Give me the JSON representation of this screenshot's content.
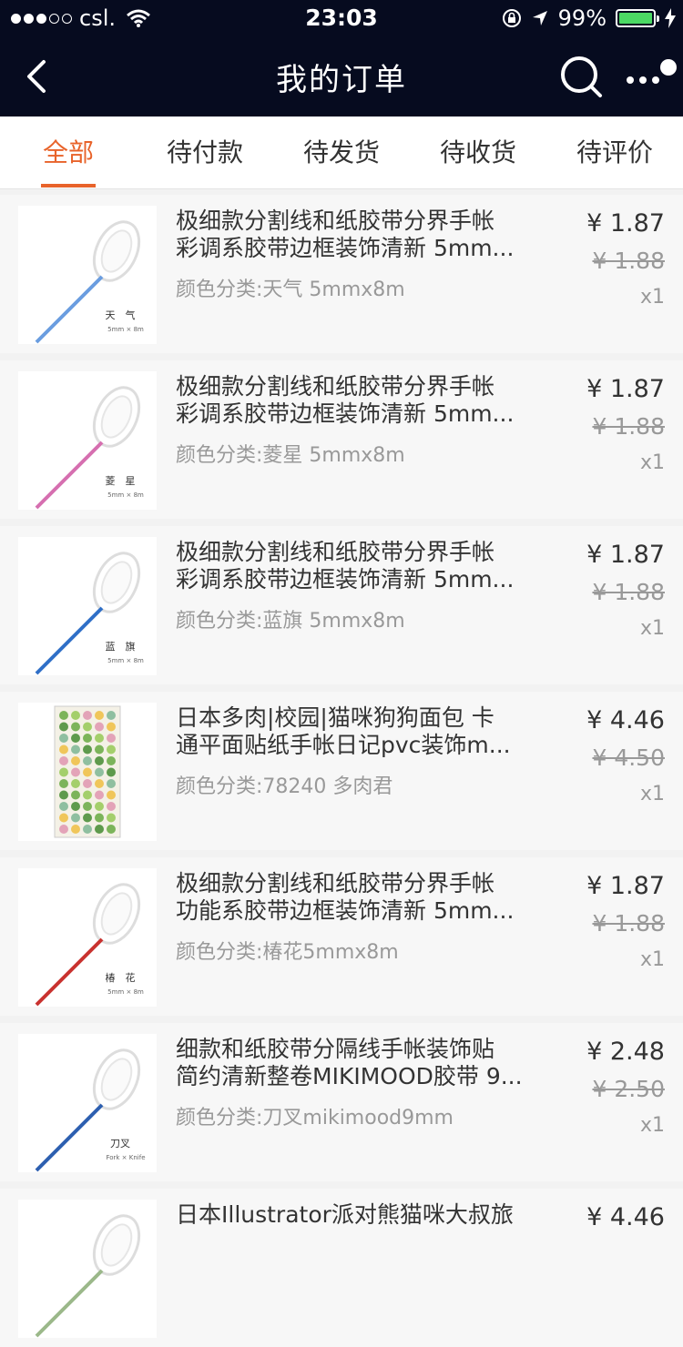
{
  "status_bar": {
    "carrier": "csl.",
    "time": "23:03",
    "battery": "99%"
  },
  "nav": {
    "title": "我的订单"
  },
  "tabs": [
    {
      "label": "全部",
      "active": true
    },
    {
      "label": "待付款",
      "active": false
    },
    {
      "label": "待发货",
      "active": false
    },
    {
      "label": "待收货",
      "active": false
    },
    {
      "label": "待评价",
      "active": false
    }
  ],
  "orders": [
    {
      "line1": "极细款分割线和纸胶带分界手帐",
      "line2": "彩调系胶带边框装饰清新 5mm...",
      "sku": "颜色分类:天气 5mmx8m",
      "price": "¥ 1.87",
      "orig": "¥ 1.88",
      "qty": "x1",
      "thumb_label": "天　气",
      "thumb_sub": "5mm × 8m",
      "thumb_color": "#6a9de0"
    },
    {
      "line1": "极细款分割线和纸胶带分界手帐",
      "line2": "彩调系胶带边框装饰清新 5mm...",
      "sku": "颜色分类:菱星 5mmx8m",
      "price": "¥ 1.87",
      "orig": "¥ 1.88",
      "qty": "x1",
      "thumb_label": "菱　星",
      "thumb_sub": "5mm × 8m",
      "thumb_color": "#d66fb0"
    },
    {
      "line1": "极细款分割线和纸胶带分界手帐",
      "line2": "彩调系胶带边框装饰清新 5mm...",
      "sku": "颜色分类:蓝旗 5mmx8m",
      "price": "¥ 1.87",
      "orig": "¥ 1.88",
      "qty": "x1",
      "thumb_label": "蓝　旗",
      "thumb_sub": "5mm × 8m",
      "thumb_color": "#2f6fc7"
    },
    {
      "line1": "日本多肉|校园|猫咪狗狗面包 卡",
      "line2": "通平面贴纸手帐日记pvc装饰m...",
      "sku": "颜色分类:78240 多肉君",
      "price": "¥ 4.46",
      "orig": "¥ 4.50",
      "qty": "x1",
      "thumb_label": "",
      "thumb_sub": "",
      "thumb_color": "#7cb45a"
    },
    {
      "line1": "极细款分割线和纸胶带分界手帐",
      "line2": "功能系胶带边框装饰清新 5mm...",
      "sku": "颜色分类:椿花5mmx8m",
      "price": "¥ 1.87",
      "orig": "¥ 1.88",
      "qty": "x1",
      "thumb_label": "椿　花",
      "thumb_sub": "5mm × 8m",
      "thumb_color": "#c9322f"
    },
    {
      "line1": "细款和纸胶带分隔线手帐装饰贴",
      "line2": "简约清新整卷MIKIMOOD胶带 9...",
      "sku": "颜色分类:刀叉mikimood9mm",
      "price": "¥ 2.48",
      "orig": "¥ 2.50",
      "qty": "x1",
      "thumb_label": "刀叉",
      "thumb_sub": "Fork × Knife",
      "thumb_color": "#2d5fb0"
    },
    {
      "line1": "日本Illustrator派对熊猫咪大叔旅",
      "line2": "",
      "sku": "",
      "price": "¥ 4.46",
      "orig": "",
      "qty": "",
      "thumb_label": "",
      "thumb_sub": "",
      "thumb_color": "#9bb88a"
    }
  ],
  "colors": {
    "accent": "#e8632a",
    "header_bg": "#060b1f"
  },
  "icons": [
    "back-icon",
    "search-icon",
    "more-icon"
  ]
}
